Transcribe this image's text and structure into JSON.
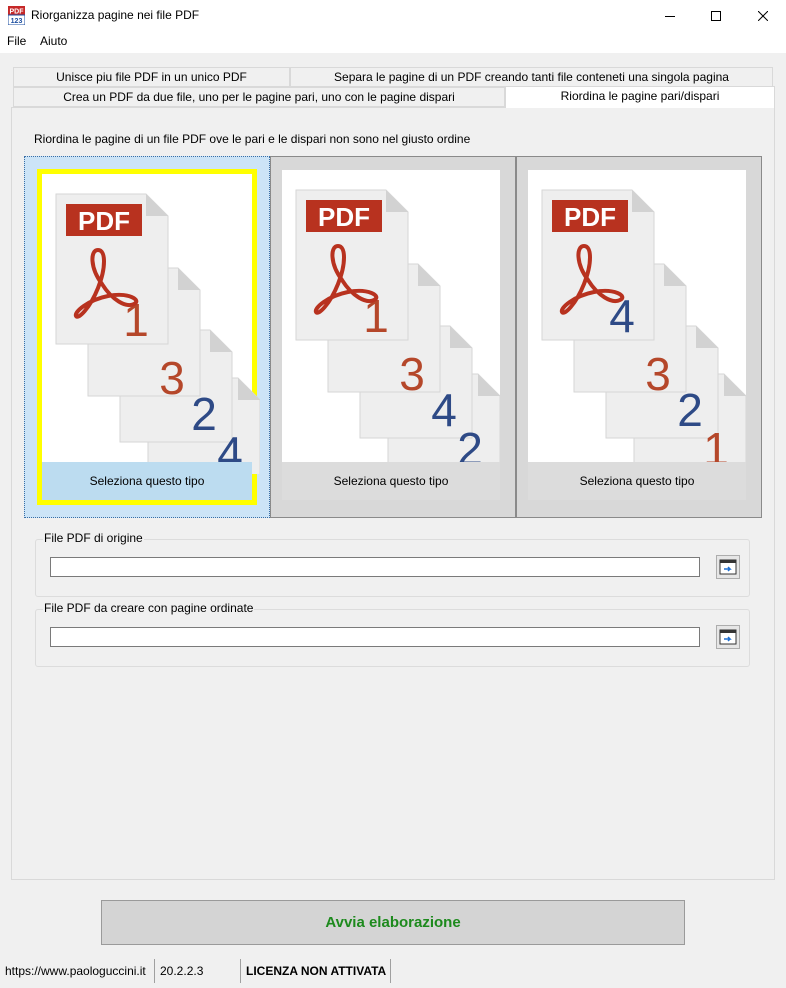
{
  "window": {
    "title": "Riorganizza pagine nei file PDF",
    "app_icon_text_top": "PDF",
    "app_icon_text_bottom": "123"
  },
  "menu": {
    "file": "File",
    "help": "Aiuto"
  },
  "tabs": [
    {
      "label": "Unisce piu file PDF in un unico PDF"
    },
    {
      "label": "Separa le pagine di un PDF creando tanti file conteneti una singola pagina"
    },
    {
      "label": "Crea un PDF da due file, uno per le pagine pari, uno con le pagine dispari"
    },
    {
      "label": "Riordina le pagine pari/dispari",
      "active": true
    }
  ],
  "panel": {
    "description": "Riordina le pagine di un file PDF ove le pari e le dispari non sono nel giusto ordine",
    "options": [
      {
        "label": "Seleziona questo tipo",
        "pages": [
          "1",
          "3",
          "2",
          "4"
        ],
        "selected": true
      },
      {
        "label": "Seleziona questo tipo",
        "pages": [
          "1",
          "3",
          "4",
          "2"
        ],
        "selected": false
      },
      {
        "label": "Seleziona questo tipo",
        "pages": [
          "4",
          "3",
          "2",
          "1"
        ],
        "selected": false
      }
    ],
    "pdf_badge": "PDF",
    "source_group": {
      "label": "File PDF di origine",
      "value": ""
    },
    "target_group": {
      "label": "File PDF da creare con pagine ordinate",
      "value": ""
    }
  },
  "run_button": "Avvia elaborazione",
  "status": {
    "url": "https://www.paologuccini.it",
    "version": "20.2.2.3",
    "license": "LICENZA NON ATTIVATA"
  },
  "colors": {
    "odd_number": "#b5472a",
    "even_number": "#2e4a86",
    "pdf_red": "#b8321f",
    "selection_border": "#ffff00",
    "run_text": "#1d8a1d"
  }
}
